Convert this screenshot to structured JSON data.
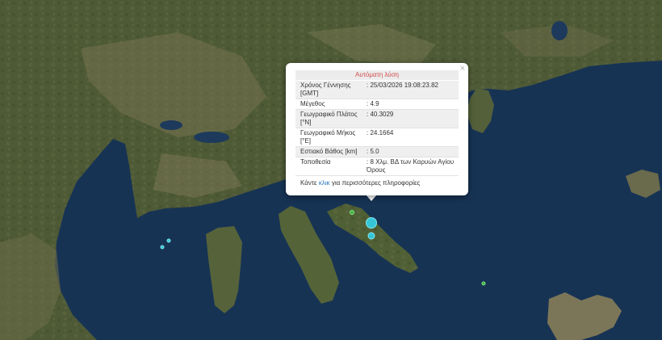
{
  "popup": {
    "title": "Αυτόματη λύση",
    "rows": [
      {
        "key": "Χρόνος Γέννησης [GMT]",
        "value": "25/03/2026 19:08:23.82"
      },
      {
        "key": "Μέγεθος",
        "value": "4.9"
      },
      {
        "key": "Γεωγραφικό Πλάτος [°N]",
        "value": "40.3029"
      },
      {
        "key": "Γεωγραφικό Μήκος [°E]",
        "value": "24.1664"
      },
      {
        "key": "Εστιακό Βάθος [km]",
        "value": "5.0"
      },
      {
        "key": "Τοποθεσία",
        "value": "8 Χλμ. ΒΔ των Καρυών Αγίου Όρους"
      }
    ],
    "more_prefix": "Κάντε",
    "more_link": "κλικ",
    "more_suffix": "για περισσότερες πληροφορίες",
    "close_symbol": "×"
  },
  "colors": {
    "sea": "#173354",
    "land": "#4d5a35",
    "popup_title": "#d24b4b",
    "link": "#2a7ac0",
    "quake_recent": "#35c5d6",
    "quake_older": "#3fb53f"
  },
  "markers": [
    {
      "type": "earthquake",
      "color": "blue",
      "magnitude_class": "large"
    },
    {
      "type": "earthquake",
      "color": "blue",
      "magnitude_class": "small"
    },
    {
      "type": "earthquake",
      "color": "green",
      "magnitude_class": "small"
    },
    {
      "type": "earthquake",
      "color": "blue",
      "magnitude_class": "small"
    },
    {
      "type": "earthquake",
      "color": "blue",
      "magnitude_class": "small"
    },
    {
      "type": "earthquake",
      "color": "green",
      "magnitude_class": "small"
    }
  ]
}
